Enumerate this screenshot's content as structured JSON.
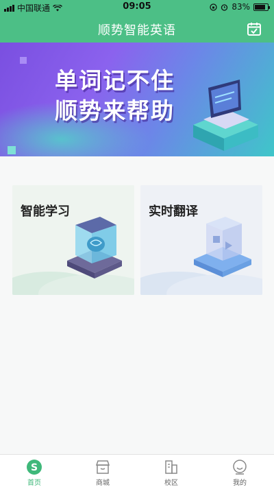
{
  "status_bar": {
    "carrier": "中国联通",
    "time": "09:05",
    "battery": "83%",
    "battery_level": 0.83
  },
  "nav": {
    "title": "顺势智能英语",
    "calendar_icon": "calendar-check-icon"
  },
  "banner": {
    "line1": "单词记不住",
    "line2": "顺势来帮助"
  },
  "cards": [
    {
      "title": "智能学习",
      "icon": "brain-cube-icon"
    },
    {
      "title": "实时翻译",
      "icon": "translate-cube-icon"
    }
  ],
  "tabbar": {
    "items": [
      {
        "label": "首页",
        "icon": "home-s-icon",
        "active": true
      },
      {
        "label": "商城",
        "icon": "shop-icon",
        "active": false
      },
      {
        "label": "校区",
        "icon": "campus-icon",
        "active": false
      },
      {
        "label": "我的",
        "icon": "profile-icon",
        "active": false
      }
    ]
  },
  "colors": {
    "brand": "#4cbf86",
    "tab_active": "#3fb87a"
  }
}
